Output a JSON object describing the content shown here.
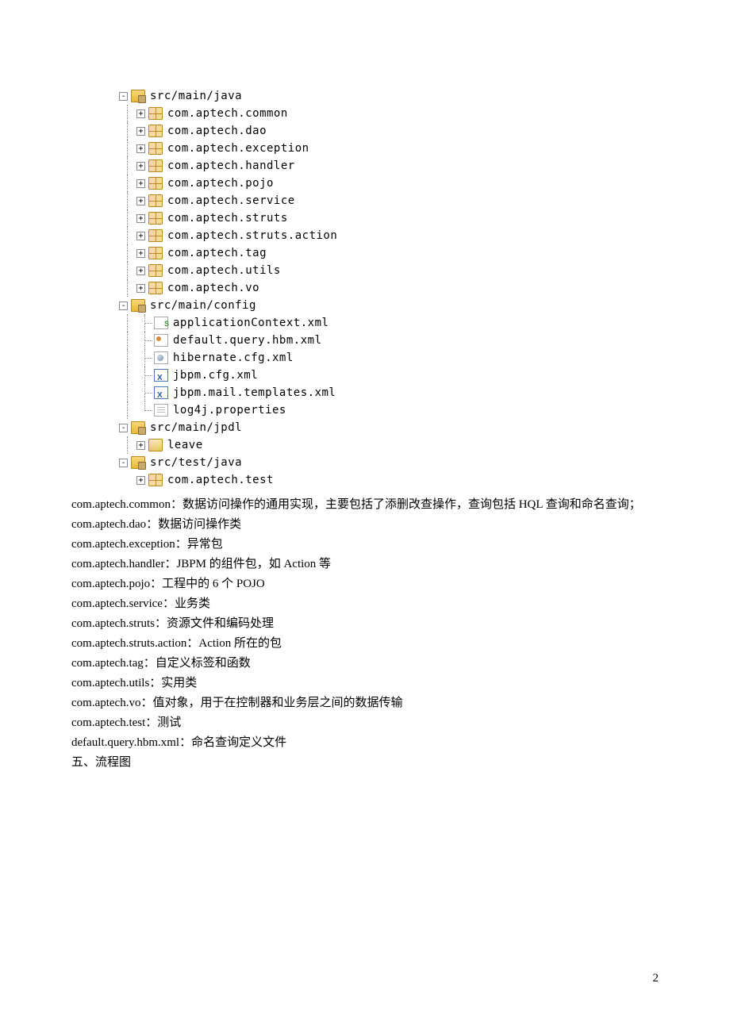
{
  "tree": {
    "src_main_java": "src/main/java",
    "packages": [
      "com.aptech.common",
      "com.aptech.dao",
      "com.aptech.exception",
      "com.aptech.handler",
      "com.aptech.pojo",
      "com.aptech.service",
      "com.aptech.struts",
      "com.aptech.struts.action",
      "com.aptech.tag",
      "com.aptech.utils",
      "com.aptech.vo"
    ],
    "src_main_config": "src/main/config",
    "config_files": {
      "spring": "applicationContext.xml",
      "hbm": "default.query.hbm.xml",
      "hib": "hibernate.cfg.xml",
      "jbpm": "jbpm.cfg.xml",
      "mail": "jbpm.mail.templates.xml",
      "log4j": "log4j.properties"
    },
    "src_main_jpdl": "src/main/jpdl",
    "leave": "leave",
    "src_test_java": "src/test/java",
    "test_pkg": "com.aptech.test"
  },
  "desc": {
    "l1": "com.aptech.common：数据访问操作的通用实现，主要包括了添删改查操作，查询包括 HQL 查询和命名查询；",
    "l2": "com.aptech.dao：数据访问操作类",
    "l3": "com.aptech.exception：异常包",
    "l4": "com.aptech.handler：JBPM 的组件包，如 Action 等",
    "l5": "com.aptech.pojo：工程中的 6 个 POJO",
    "l6": "com.aptech.service：业务类",
    "l7": "com.aptech.struts：资源文件和编码处理",
    "l8": "com.aptech.struts.action：Action 所在的包",
    "l9": "com.aptech.tag：自定义标签和函数",
    "l10": "com.aptech.utils：实用类",
    "l11": "com.aptech.vo：值对象，用于在控制器和业务层之间的数据传输",
    "l12": "com.aptech.test：测试",
    "l13": "default.query.hbm.xml：命名查询定义文件"
  },
  "heading": "五、流程图",
  "page_number": "2"
}
